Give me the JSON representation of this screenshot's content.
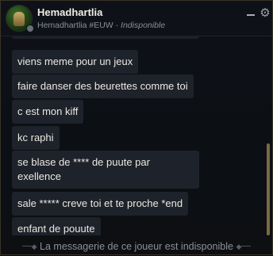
{
  "header": {
    "display_name": "Hemadhartlia",
    "riot_id": "Hemadhartlia #EUW",
    "separator": "-",
    "status": "Indisponible",
    "minimize_icon": "minimize-icon",
    "settings_icon": "gear-icon"
  },
  "messages": [
    "viens meme pour un jeux",
    "faire danser des beurettes comme toi",
    "c est mon kiff",
    "kc raphi",
    "se blase de **** de puute par exellence",
    "sale ***** creve toi et te proche *end",
    "enfant de pouute"
  ],
  "footer": {
    "notice": "La messagerie de ce joueur est indisponible"
  },
  "colors": {
    "background": "#0b0e13",
    "bubble": "#1e222a",
    "accent_gold": "#7a6a45"
  }
}
